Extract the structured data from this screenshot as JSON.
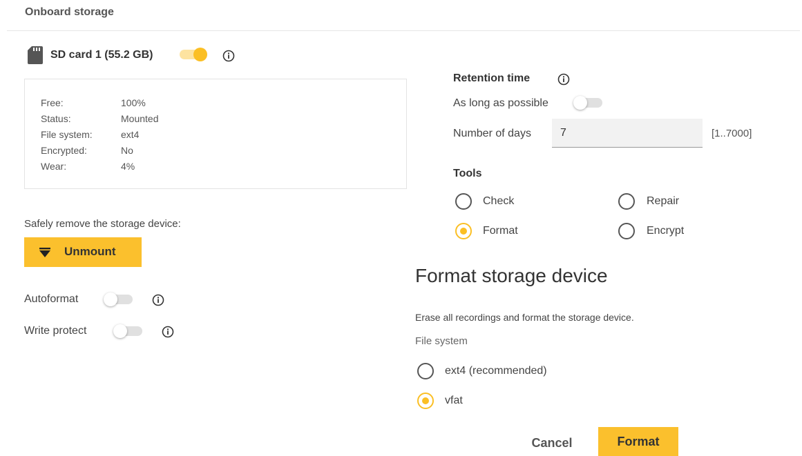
{
  "header": {
    "title": "Onboard storage"
  },
  "colors": {
    "accent": "#fbbf24",
    "accent_button": "#fbc02d"
  },
  "storage": {
    "label": "SD card 1 (55.2 GB)",
    "enabled": true,
    "details": [
      {
        "key": "Free:",
        "value": "100%"
      },
      {
        "key": "Status:",
        "value": "Mounted"
      },
      {
        "key": "File system:",
        "value": "ext4"
      },
      {
        "key": "Encrypted:",
        "value": "No"
      },
      {
        "key": "Wear:",
        "value": "4%"
      }
    ]
  },
  "remove": {
    "text": "Safely remove the storage device:",
    "button_label": "Unmount",
    "button_icon": "eject-icon"
  },
  "autoformat": {
    "label": "Autoformat",
    "enabled": false
  },
  "write_protect": {
    "label": "Write protect",
    "enabled": false
  },
  "retention": {
    "title": "Retention time",
    "long_as_possible_label": "As long as possible",
    "long_as_possible_enabled": false,
    "days_label": "Number of days",
    "days_value": "7",
    "days_range": "[1..7000]"
  },
  "tools": {
    "title": "Tools",
    "options": [
      {
        "label": "Check",
        "selected": false
      },
      {
        "label": "Repair",
        "selected": false
      },
      {
        "label": "Format",
        "selected": true
      },
      {
        "label": "Encrypt",
        "selected": false
      }
    ]
  },
  "format_dialog": {
    "heading": "Format storage device",
    "description": "Erase all recordings and format the storage device.",
    "fs_label": "File system",
    "fs_options": [
      {
        "label": "ext4 (recommended)",
        "selected": false
      },
      {
        "label": "vfat",
        "selected": true
      }
    ],
    "cancel_label": "Cancel",
    "format_label": "Format"
  }
}
